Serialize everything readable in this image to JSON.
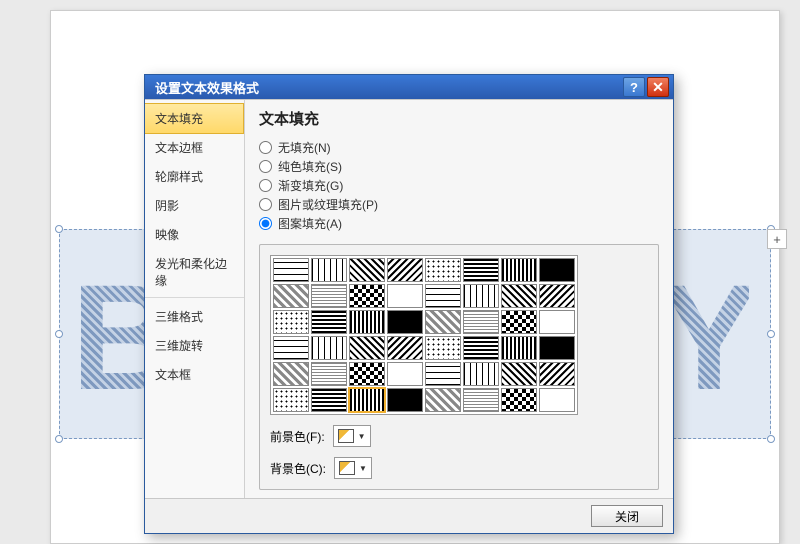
{
  "dialog": {
    "title": "设置文本效果格式",
    "close_label": "关闭"
  },
  "sidebar": {
    "items": [
      "文本填充",
      "文本边框",
      "轮廓样式",
      "阴影",
      "映像",
      "发光和柔化边缘",
      "三维格式",
      "三维旋转",
      "文本框"
    ],
    "selected_index": 0
  },
  "panel": {
    "heading": "文本填充",
    "options": [
      {
        "label": "无填充(N)",
        "value": "none"
      },
      {
        "label": "纯色填充(S)",
        "value": "solid"
      },
      {
        "label": "渐变填充(G)",
        "value": "gradient"
      },
      {
        "label": "图片或纹理填充(P)",
        "value": "picture"
      },
      {
        "label": "图案填充(A)",
        "value": "pattern"
      }
    ],
    "selected_option": "pattern",
    "foreground_label": "前景色(F):",
    "background_label": "背景色(C):",
    "rows": 6,
    "cols": 8,
    "selected_swatch": 42
  },
  "colors": {
    "titlebar_grad_top": "#3a78d6",
    "titlebar_grad_bottom": "#2a5aae",
    "close_red": "#d03010",
    "sel_highlight": "#ffd96a"
  }
}
